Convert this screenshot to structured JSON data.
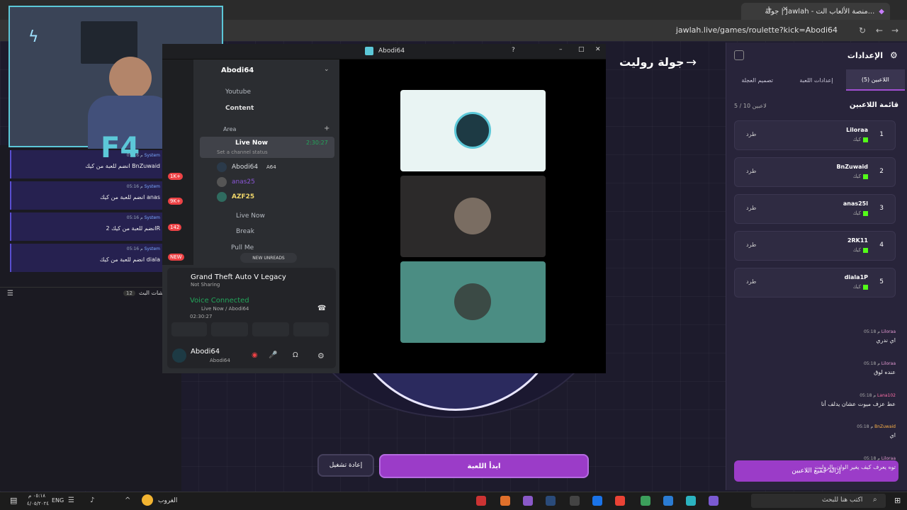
{
  "browser": {
    "tab_title": "جولة | Jawlah - منصة الألعاب الت...",
    "url": "jawlah.live/games/roulette?kick=Abodi64"
  },
  "main": {
    "title": "جولة روليت",
    "start_label": "ابدأ اللعبة",
    "reset_label": "إعادة تشغيل"
  },
  "settings": {
    "title": "الإعدادات",
    "tabs": [
      "اللاعبين (5)",
      "إعدادات اللعبة",
      "تصميم العجلة"
    ],
    "players_heading": "قائمة اللاعبين",
    "players_count": "5 / 10 لاعبين",
    "kick_label": "طرد",
    "remove_all": "إزالة جميع اللاعبين",
    "players": [
      {
        "num": "1",
        "name": "Liloraa",
        "platform": "كيك"
      },
      {
        "num": "2",
        "name": "BnZuwaid",
        "platform": "كيك"
      },
      {
        "num": "3",
        "name": "anas25l",
        "platform": "كيك"
      },
      {
        "num": "4",
        "name": "2RK11",
        "platform": "كيك"
      },
      {
        "num": "5",
        "name": "diala1P",
        "platform": "كيك"
      }
    ]
  },
  "chat": {
    "header": "شات البث",
    "header_count": "12",
    "system_messages": [
      {
        "time": "05:16 م",
        "user": "System",
        "text": "انضم للعبة من كيك BnZuwaid"
      },
      {
        "time": "05:16 م",
        "user": "System",
        "text": "انضم للعبة من كيك anas"
      },
      {
        "time": "05:16 م",
        "user": "System",
        "text": "انضم للعبة من كيك 2R"
      },
      {
        "time": "05:16 م",
        "user": "System",
        "text": "انضم للعبة من كيك diala"
      }
    ],
    "messages": [
      {
        "time": "05:18 م",
        "user": "Liloraa",
        "text": "اي ندري"
      },
      {
        "time": "05:18 م",
        "user": "Liloraa",
        "text": "عنده لوق"
      },
      {
        "time": "05:18 م",
        "user": "Lana102",
        "text": "عط عزف ميوت عشان يدلف أنا"
      },
      {
        "time": "05:18 م",
        "user": "BnZuwaid",
        "text": "اي"
      },
      {
        "time": "05:18 م",
        "user": "Liloraa",
        "text": "توه يعرف كيف يغير الوان بالروليت"
      }
    ]
  },
  "discord": {
    "window_title": "Abodi64",
    "server_name": "Abodi64",
    "channels": [
      "Youtube",
      "Content"
    ],
    "category": "Area",
    "live_channel": "Live Now",
    "live_timer": "2:30:27",
    "set_status": "Set a channel status",
    "members": [
      "Abodi64",
      "anas25",
      "AZF25"
    ],
    "member_tag": "A64",
    "other_channels": [
      "Live Now",
      "Break",
      "Pull Me"
    ],
    "new_unreads": "NEW UNREADS",
    "activity_game": "Grand Theft Auto V Legacy",
    "activity_status": "Not Sharing",
    "voice_connected": "Voice Connected",
    "voice_channel": "Live Now / Abodi64",
    "voice_timer": "02:30:27",
    "user_name": "Abodi64",
    "user_sub": "Abodi64",
    "badges": [
      "1K+",
      "9K+",
      "142",
      "NEW"
    ]
  },
  "taskbar": {
    "search_placeholder": "اكتب هنا للبحث",
    "weather": "الغروب",
    "time": "٠٥:١٨ م",
    "date": "٤/٠٥/٢٠٢٤",
    "lang": "ENG"
  },
  "colors": {
    "accent": "#9b3cc8",
    "kick": "#53fc18",
    "panel": "#28243a"
  }
}
